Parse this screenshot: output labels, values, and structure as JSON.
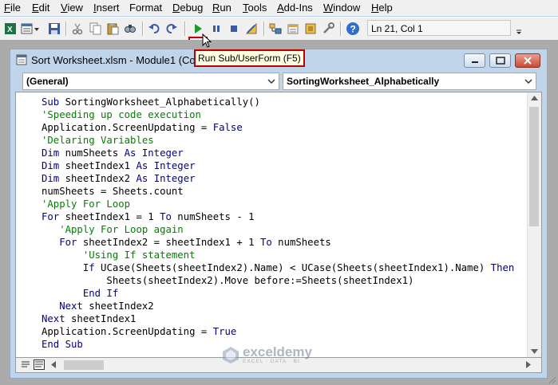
{
  "menubar": {
    "items": [
      {
        "label": "File",
        "ul": "F",
        "rest": "ile"
      },
      {
        "label": "Edit",
        "ul": "E",
        "rest": "dit"
      },
      {
        "label": "View",
        "ul": "V",
        "rest": "iew"
      },
      {
        "label": "Insert",
        "ul": "I",
        "rest": "nsert"
      },
      {
        "label": "Format",
        "ul": "",
        "rest": "Format"
      },
      {
        "label": "Debug",
        "ul": "D",
        "rest": "ebug"
      },
      {
        "label": "Run",
        "ul": "R",
        "rest": "un"
      },
      {
        "label": "Tools",
        "ul": "T",
        "rest": "ools"
      },
      {
        "label": "Add-Ins",
        "ul": "A",
        "rest": "dd-Ins"
      },
      {
        "label": "Window",
        "ul": "W",
        "rest": "indow"
      },
      {
        "label": "Help",
        "ul": "H",
        "rest": "elp"
      }
    ]
  },
  "toolbar": {
    "cursor_position": "Ln 21, Col 1",
    "icons": [
      "excel-icon",
      "insert-module-icon",
      "save-icon",
      "cut-icon",
      "copy-icon",
      "paste-icon",
      "find-icon",
      "undo-icon",
      "redo-icon",
      "run-icon",
      "break-icon",
      "reset-icon",
      "design-mode-icon",
      "project-explorer-icon",
      "properties-icon",
      "object-browser-icon",
      "toolbox-icon",
      "help-icon"
    ]
  },
  "tooltip": "Run Sub/UserForm (F5)",
  "code_window": {
    "title": "Sort Worksheet.xlsm - Module1 (Code)",
    "object_combo": "(General)",
    "procedure_combo": "SortingWorksheet_Alphabetically"
  },
  "code_lines": [
    "Sub SortingWorksheet_Alphabetically()",
    "'Speeding up code execution",
    "Application.ScreenUpdating = False",
    "'Delaring Variables",
    "Dim numSheets As Integer",
    "Dim sheetIndex1 As Integer",
    "Dim sheetIndex2 As Integer",
    "numSheets = Sheets.count",
    "'Apply For Loop",
    "For sheetIndex1 = 1 To numSheets - 1",
    "   'Apply For Loop again",
    "   For sheetIndex2 = sheetIndex1 + 1 To numSheets",
    "       'Using If statement",
    "       If UCase(Sheets(sheetIndex2).Name) < UCase(Sheets(sheetIndex1).Name) Then",
    "           Sheets(sheetIndex2).Move before:=Sheets(sheetIndex1)",
    "       End If",
    "   Next sheetIndex2",
    "Next sheetIndex1",
    "Application.ScreenUpdating = True",
    "End Sub"
  ],
  "watermark": {
    "name": "exceldemy",
    "tagline": "EXCEL · DATA · BI"
  },
  "colors": {
    "keyword": "#00008b",
    "comment": "#008000",
    "highlight": "#c00000"
  }
}
